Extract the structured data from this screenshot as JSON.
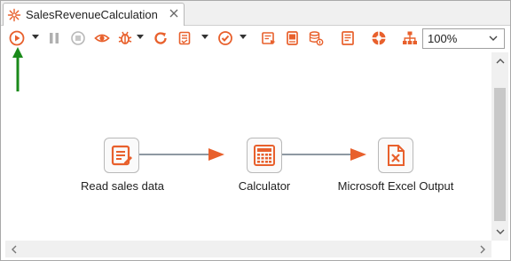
{
  "colors": {
    "accent": "#e8602c",
    "hop": "#4a5a6a",
    "pointer": "#1a8a1a"
  },
  "tab": {
    "title": "SalesRevenueCalculation",
    "icon": "transformation-icon",
    "close_icon": "close-icon"
  },
  "toolbar": {
    "buttons": [
      {
        "name": "run-icon"
      },
      {
        "name": "pause-icon"
      },
      {
        "name": "stop-icon"
      },
      {
        "name": "preview-icon"
      },
      {
        "name": "debug-icon"
      },
      {
        "name": "replay-icon"
      },
      {
        "name": "verify-icon"
      },
      {
        "name": "check-icon"
      },
      {
        "name": "sql-icon"
      },
      {
        "name": "explore-db-icon"
      },
      {
        "name": "impact-icon"
      },
      {
        "name": "log-icon"
      },
      {
        "name": "help-icon"
      },
      {
        "name": "layout-icon"
      }
    ],
    "zoom": "100%"
  },
  "canvas": {
    "steps": [
      {
        "label": "Read sales data",
        "icon": "text-file-input-icon"
      },
      {
        "label": "Calculator",
        "icon": "calculator-icon"
      },
      {
        "label": "Microsoft Excel Output",
        "icon": "excel-output-icon"
      }
    ]
  }
}
